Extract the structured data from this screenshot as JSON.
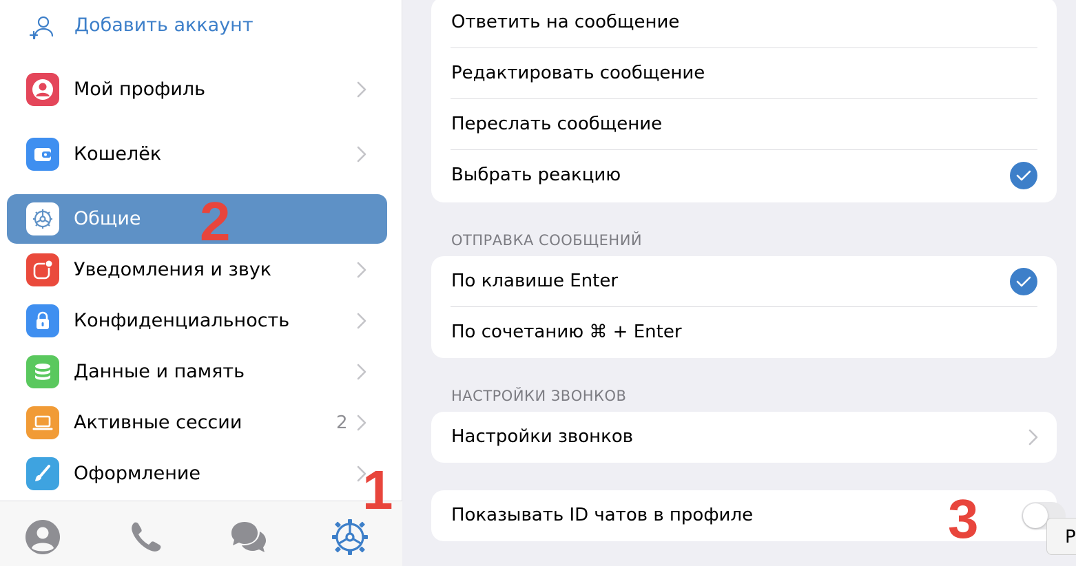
{
  "sidebar": {
    "add_account": {
      "label": "Добавить аккаунт",
      "icon": "add-account-icon"
    },
    "items": [
      {
        "label": "Мой профиль",
        "icon": "profile-icon",
        "color": "#e4465a"
      },
      {
        "label": "Кошелёк",
        "icon": "wallet-icon",
        "color": "#3f8ff0"
      },
      {
        "label": "Общие",
        "icon": "gear-icon",
        "color": "#ffffff",
        "active": true
      },
      {
        "label": "Уведомления и звук",
        "icon": "notifications-icon",
        "color": "#ea4a3c"
      },
      {
        "label": "Конфиденциальность",
        "icon": "lock-icon",
        "color": "#3f8ff0"
      },
      {
        "label": "Данные и память",
        "icon": "database-icon",
        "color": "#5ac85e"
      },
      {
        "label": "Активные сессии",
        "icon": "laptop-icon",
        "color": "#f19b36",
        "count": "2"
      },
      {
        "label": "Оформление",
        "icon": "brush-icon",
        "color": "#3ea3e0"
      }
    ],
    "tabs": [
      "contacts-tab",
      "calls-tab",
      "chats-tab",
      "settings-tab"
    ]
  },
  "annotations": {
    "one": "1",
    "two": "2",
    "three": "3"
  },
  "main": {
    "double_tap_rows": [
      {
        "label": "Ответить на сообщение",
        "checked": false
      },
      {
        "label": "Редактировать сообщение",
        "checked": false
      },
      {
        "label": "Переслать сообщение",
        "checked": false
      },
      {
        "label": "Выбрать реакцию",
        "checked": true
      }
    ],
    "send_section_header": "ОТПРАВКА СООБЩЕНИЙ",
    "send_rows": [
      {
        "label": "По клавише Enter",
        "checked": true
      },
      {
        "label": "По сочетанию ⌘ + Enter",
        "checked": false
      }
    ],
    "calls_section_header": "НАСТРОЙКИ ЗВОНКОВ",
    "calls_row": {
      "label": "Настройки звонков"
    },
    "show_id_row": {
      "label": "Показывать ID чатов в профиле",
      "toggle_on": false
    },
    "float_chip": "Р"
  },
  "colors": {
    "accent": "#3d7fc9",
    "active_bg": "#5e91c6",
    "annotation": "#e8453c"
  }
}
